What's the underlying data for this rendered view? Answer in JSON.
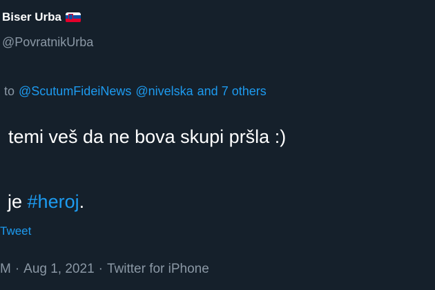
{
  "author": {
    "display_name": "Biser Urba",
    "handle": "@PovratnikUrba",
    "flag_icon": "slovenia-flag-icon"
  },
  "reply": {
    "prefix": "to",
    "mentions": [
      "@ScutumFideiNews",
      "@nivelska"
    ],
    "others": "and 7 others"
  },
  "tweet": {
    "line1": "temi veš da ne bova skupi pršla :)",
    "line2_text": "je",
    "hashtag": "#heroj",
    "line2_end": "."
  },
  "translate_link": "Tweet",
  "meta": {
    "time": "M",
    "date": "Aug 1, 2021",
    "source": "Twitter for iPhone"
  },
  "colors": {
    "background": "#15202b",
    "link": "#1d9bf0",
    "secondary_text": "#8b98a5"
  }
}
